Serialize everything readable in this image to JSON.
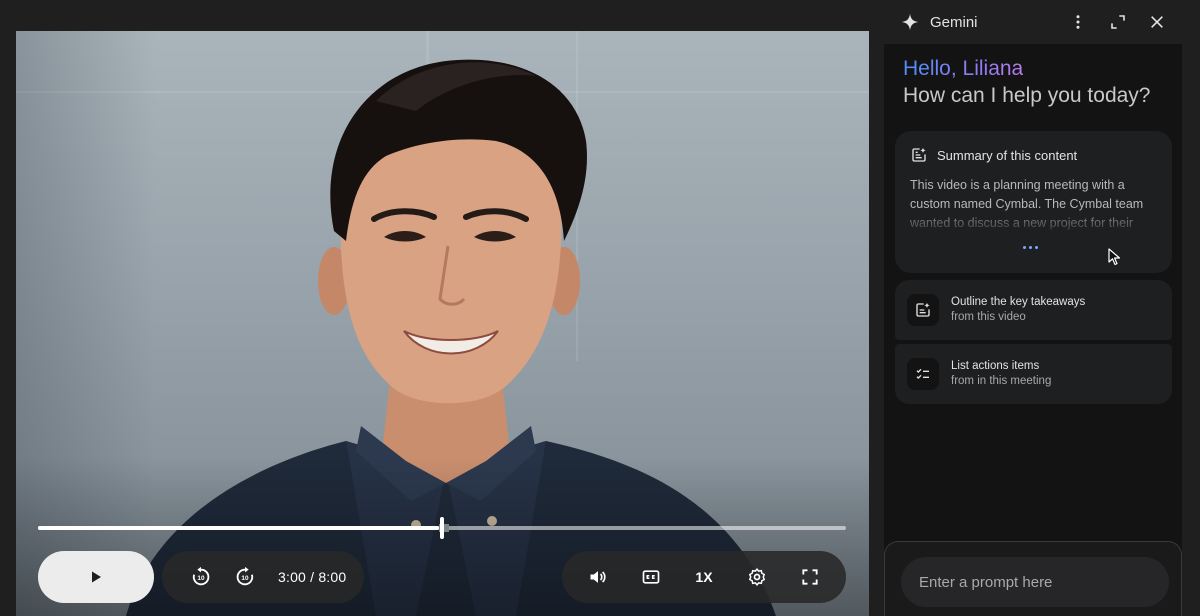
{
  "player": {
    "time_display": "3:00 / 8:00",
    "progress_fraction": 0.5,
    "speed_label": "1X",
    "seek_back_seconds": "10",
    "seek_forward_seconds": "10"
  },
  "gemini": {
    "title": "Gemini",
    "greeting_name": "Hello, Liliana",
    "greeting_question": "How can I help you today?",
    "summary": {
      "title": "Summary of this content",
      "text": "This video is a planning meeting with a custom named Cymbal. The Cymbal team wanted to discuss a new project for their"
    },
    "suggestions": [
      {
        "line1": "Outline the key takeaways",
        "line2": "from this video",
        "icon": "note-sparkle-icon"
      },
      {
        "line1": "List actions items",
        "line2": "from in this meeting",
        "icon": "checklist-icon"
      }
    ],
    "prompt_placeholder": "Enter a prompt here"
  },
  "colors": {
    "panel_bg": "#131314",
    "card_bg": "#1e1f20",
    "accent_blue": "#4b8ff7",
    "accent_purple": "#b57be8"
  }
}
